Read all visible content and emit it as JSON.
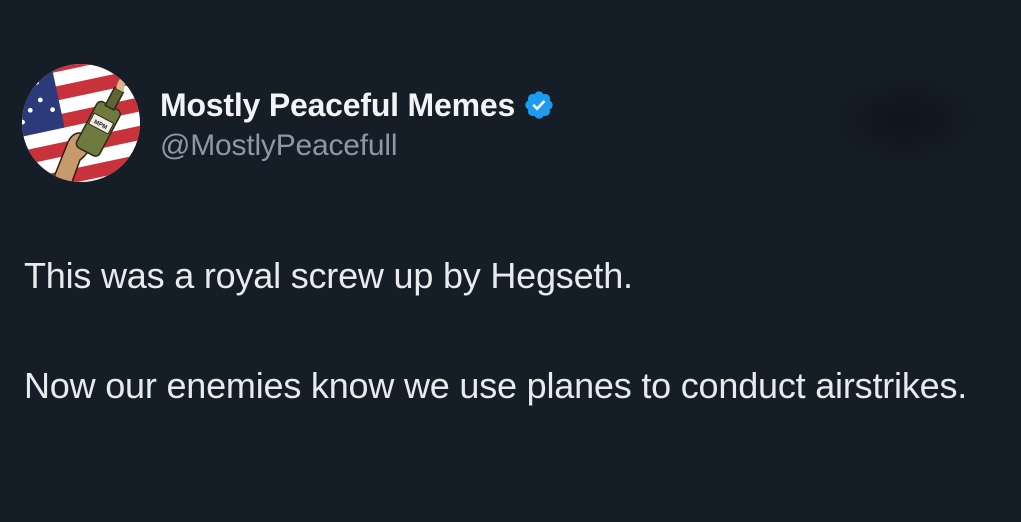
{
  "tweet": {
    "display_name": "Mostly Peaceful Memes",
    "handle": "@MostlyPeacefull",
    "verified": true,
    "paragraphs": [
      "This was a royal screw up by Hegseth.",
      "Now our enemies know we use planes to conduct airstrikes."
    ]
  },
  "icons": {
    "verified": "verified-badge-icon",
    "avatar": "avatar"
  },
  "colors": {
    "background": "#151d26",
    "display_name": "#f1f3f5",
    "handle": "#8b98a5",
    "body_text": "#e8ebee",
    "verified_badge": "#1d9bf0"
  }
}
